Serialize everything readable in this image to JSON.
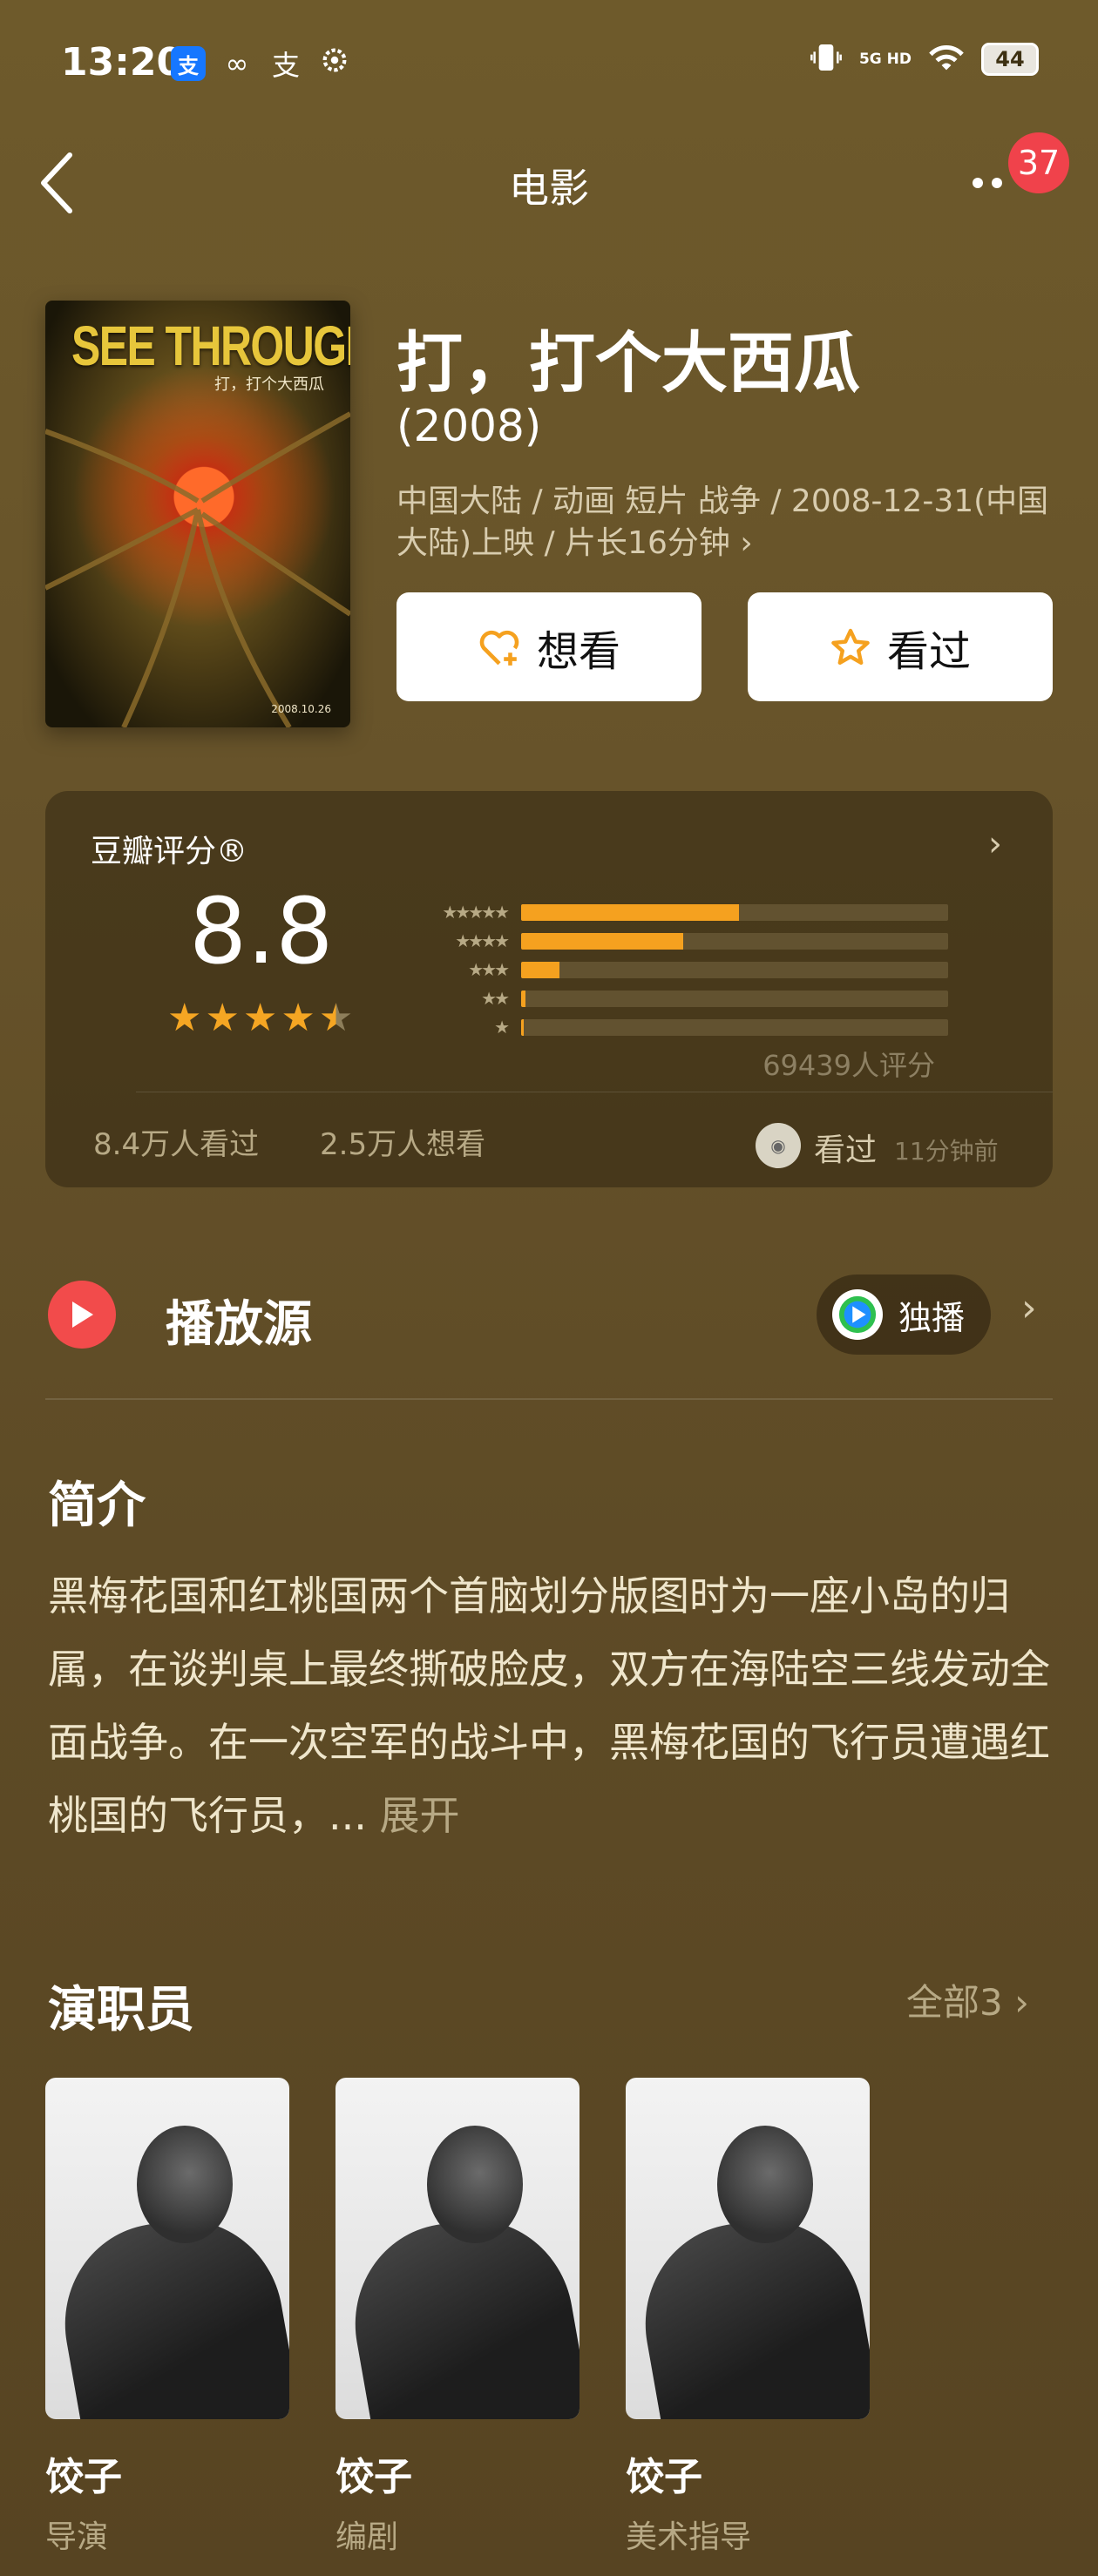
{
  "status_bar": {
    "time": "13:20",
    "app_icon_text": "支",
    "glyph_1": "∞",
    "glyph_2": "支",
    "network": "5G HD",
    "battery": "44"
  },
  "nav": {
    "title": "电影",
    "badge_count": "37"
  },
  "poster": {
    "title": "SEE THROUGH",
    "subtitle": "打，打个大西瓜",
    "date": "2008.10.26"
  },
  "movie": {
    "title": "打，打个大西瓜",
    "year": "(2008)",
    "meta": "中国大陆 / 动画 短片 战争 / 2008-12-31(中国大陆)上映 / 片长16分钟 ›",
    "want_label": "想看",
    "seen_label": "看过"
  },
  "rating": {
    "label": "豆瓣评分®",
    "score": "8.8",
    "stars_value": 4.5,
    "distribution": [
      {
        "stars": "★★★★★",
        "fraction": 0.51
      },
      {
        "stars": "★★★★",
        "fraction": 0.38
      },
      {
        "stars": "★★★",
        "fraction": 0.09
      },
      {
        "stars": "★★",
        "fraction": 0.01
      },
      {
        "stars": "★",
        "fraction": 0.005
      }
    ],
    "vote_count": "69439人评分",
    "watched": "8.4万人看过",
    "wish": "2.5万人想看",
    "my_status": "看过",
    "my_time": "11分钟前"
  },
  "source": {
    "title": "播放源",
    "exclusive_label": "独播"
  },
  "synopsis": {
    "title": "简介",
    "text": "黑梅花国和红桃国两个首脑划分版图时为一座小岛的归属，在谈判桌上最终撕破脸皮，双方在海陆空三线发动全面战争。在一次空军的战斗中，黑梅花国的飞行员遭遇红桃国的飞行员，... ",
    "expand_label": "展开"
  },
  "cast": {
    "title": "演职员",
    "all_label": "全部3 ›",
    "members": [
      {
        "name": "饺子",
        "role": "导演"
      },
      {
        "name": "饺子",
        "role": "编剧"
      },
      {
        "name": "饺子",
        "role": "美术指导"
      }
    ]
  },
  "colors": {
    "accent": "#f5a11f",
    "badge": "#f0424b",
    "play": "#f24b4b"
  }
}
